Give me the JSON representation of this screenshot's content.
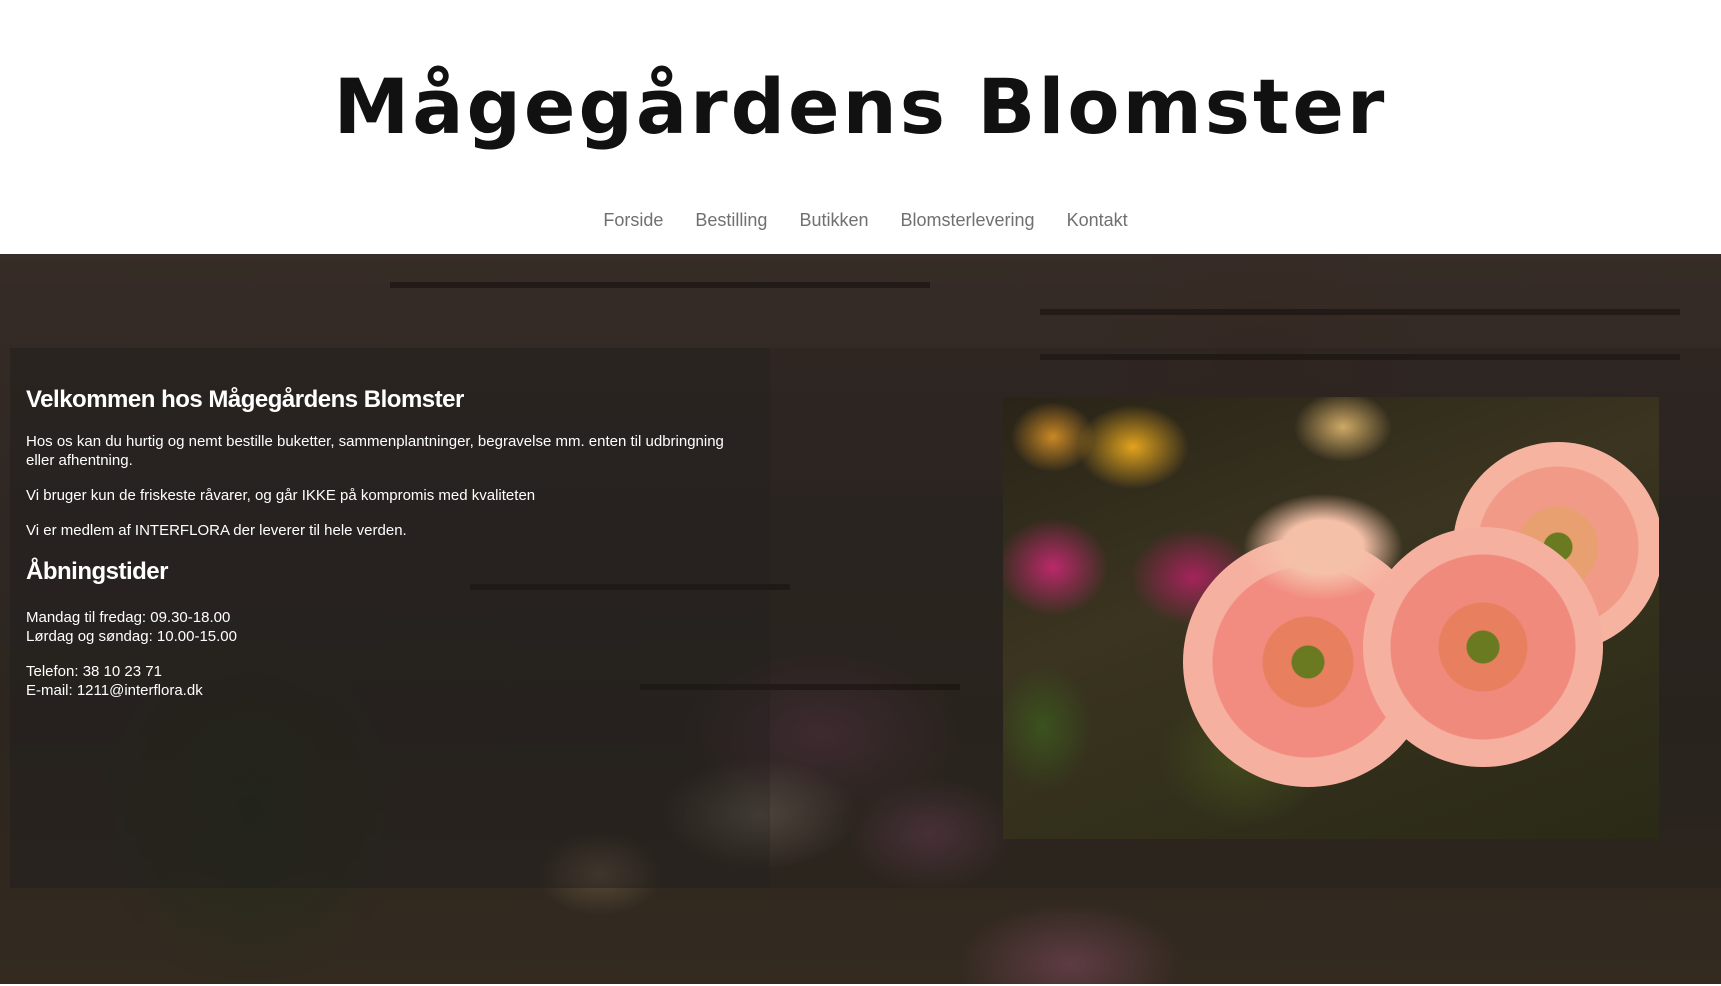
{
  "site": {
    "title": "Mågegårdens Blomster"
  },
  "nav": {
    "items": [
      {
        "label": "Forside"
      },
      {
        "label": "Bestilling"
      },
      {
        "label": "Butikken"
      },
      {
        "label": "Blomsterlevering"
      },
      {
        "label": "Kontakt"
      }
    ]
  },
  "main": {
    "heading": "Velkommen hos Mågegårdens Blomster",
    "intro": "Hos os kan du hurtig og nemt bestille buketter, sammenplantninger, begravelse mm. enten til udbringning eller afhentning.",
    "quality": "Vi bruger kun de friskeste råvarer, og går IKKE på kompromis med kvaliteten",
    "interflora": "Vi er medlem af INTERFLORA der leverer til hele verden.",
    "hours_heading": "Åbningstider",
    "hours_weekdays": "Mandag til fredag: 09.30-18.00",
    "hours_weekend": "Lørdag og søndag: 10.00-15.00",
    "phone": "Telefon: 38 10 23 71",
    "email": "E-mail: 1211@interflora.dk"
  },
  "colors": {
    "title": "#111111",
    "nav_text": "#707070",
    "hero_text": "#ffffff"
  },
  "icons": {
    "storefront_photo": "flower-shop-interior-photo",
    "flower_photo": "gerbera-bouquet-photo"
  }
}
